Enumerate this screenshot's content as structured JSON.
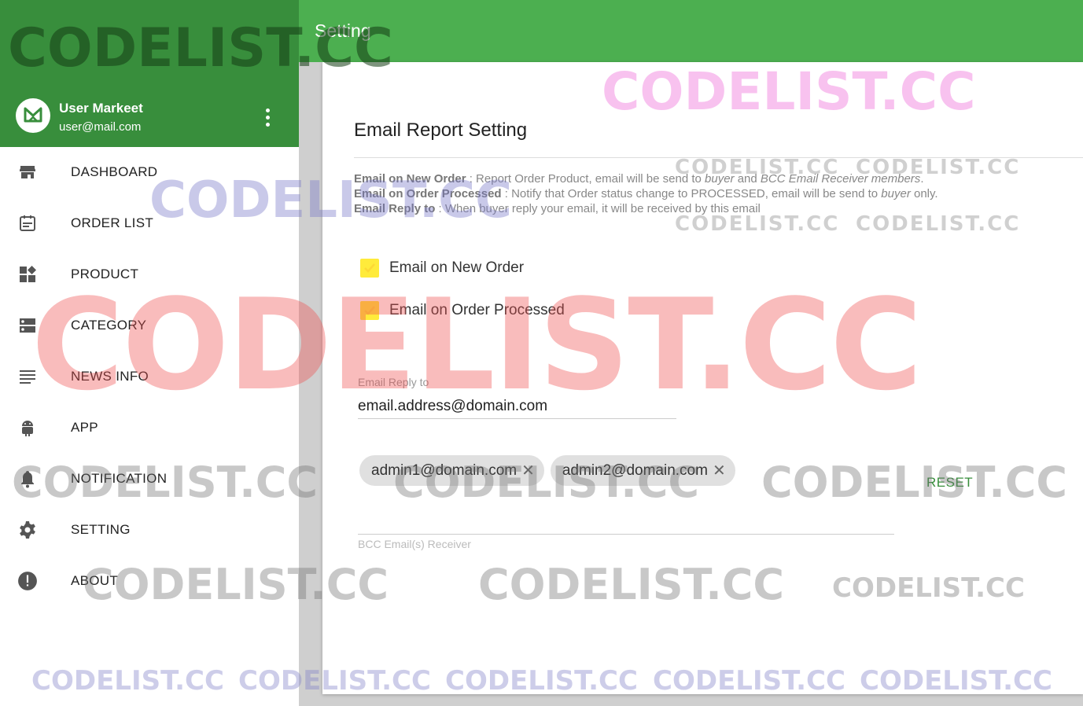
{
  "app": {
    "user_name": "User Markeet",
    "user_email": "user@mail.com",
    "accent_dark": "#388e3c",
    "accent": "#4caf50"
  },
  "sidebar": {
    "items": [
      {
        "label": "DASHBOARD",
        "icon": "store-icon"
      },
      {
        "label": "ORDER LIST",
        "icon": "calendar-icon"
      },
      {
        "label": "PRODUCT",
        "icon": "widgets-icon"
      },
      {
        "label": "CATEGORY",
        "icon": "dns-icon"
      },
      {
        "label": "NEWS INFO",
        "icon": "lines-icon"
      },
      {
        "label": "APP",
        "icon": "android-icon"
      },
      {
        "label": "NOTIFICATION",
        "icon": "bell-icon"
      },
      {
        "label": "SETTING",
        "icon": "gear-icon"
      },
      {
        "label": "ABOUT",
        "icon": "alert-circle-icon"
      }
    ]
  },
  "header": {
    "title": "Setting"
  },
  "main": {
    "card_title": "Email Report Setting",
    "desc": {
      "line1_key": "Email on New Order",
      "line1_a": " : Report Order Product, email will be send to ",
      "line1_buyer": "buyer",
      "line1_b": " and ",
      "line1_bcc": "BCC Email Receiver members",
      "line1_c": ".",
      "line2_key": "Email on Order Processed",
      "line2_a": " : Notify that Order status change to PROCESSED, email will be send to ",
      "line2_buyer": "buyer",
      "line2_b": " only.",
      "line3_key": "Email Reply to",
      "line3_a": " : When buyer reply your email, it will be received by this email"
    },
    "check_new_order": "Email on New Order",
    "check_processed": "Email on Order Processed",
    "reply_label": "Email Reply to",
    "reply_value": "email.address@domain.com",
    "chips": [
      "admin1@domain.com",
      "admin2@domain.com"
    ],
    "chip_remove": "✕",
    "bcc_label": "BCC Email(s) Receiver",
    "reset_label": "RESET"
  },
  "watermark": "CODELIST.CC"
}
